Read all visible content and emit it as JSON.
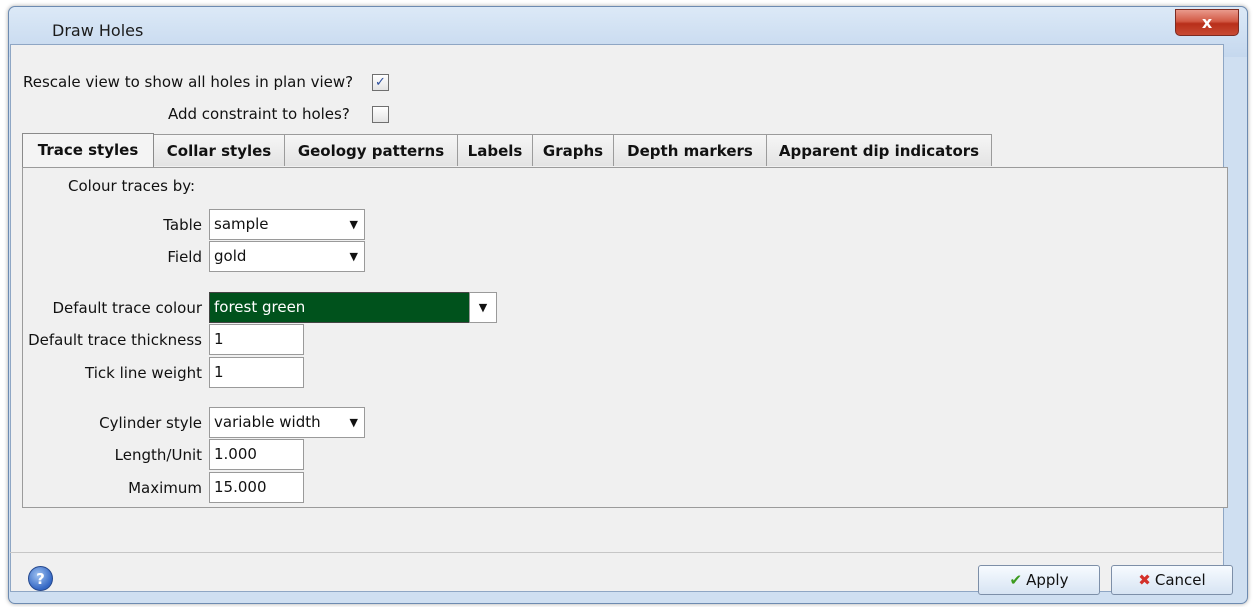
{
  "window": {
    "title": "Draw Holes",
    "close_label": "x"
  },
  "options": {
    "rescale_label": "Rescale view to show all holes in plan view?",
    "rescale_checked": "✓",
    "constraint_label": "Add constraint to holes?"
  },
  "tabs": [
    {
      "label": "Trace styles"
    },
    {
      "label": "Collar styles"
    },
    {
      "label": "Geology patterns"
    },
    {
      "label": "Labels"
    },
    {
      "label": "Graphs"
    },
    {
      "label": "Depth markers"
    },
    {
      "label": "Apparent dip indicators"
    }
  ],
  "trace": {
    "heading": "Colour traces by:",
    "table_label": "Table",
    "table_value": "sample",
    "field_label": "Field",
    "field_value": "gold",
    "default_colour_label": "Default trace colour",
    "default_colour_value": "forest green",
    "default_colour_hex": "#00521c",
    "thickness_label": "Default trace thickness",
    "thickness_value": "1",
    "tick_label": "Tick line weight",
    "tick_value": "1",
    "cylinder_label": "Cylinder style",
    "cylinder_value": "variable width",
    "length_label": "Length/Unit",
    "length_value": "1.000",
    "maximum_label": "Maximum",
    "maximum_value": "15.000"
  },
  "footer": {
    "help_icon": "?",
    "apply_label": "Apply",
    "apply_icon": "✔",
    "cancel_label": "Cancel",
    "cancel_icon": "✖"
  },
  "icons": {
    "dropdown": "chevron-down-icon"
  }
}
